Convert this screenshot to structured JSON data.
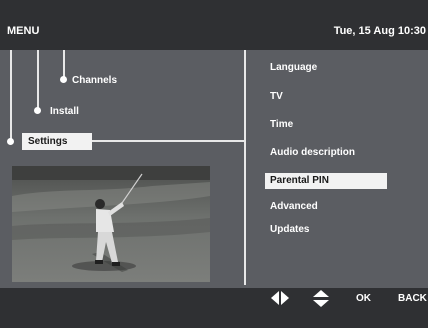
{
  "header": {
    "title": "MENU",
    "datetime": "Tue, 15 Aug 10:30"
  },
  "tree": {
    "level1": "Channels",
    "level2": "Install",
    "level3": "Settings"
  },
  "submenu": {
    "items": [
      "Language",
      "TV",
      "Time",
      "Audio description",
      "Parental PIN",
      "Advanced",
      "Updates"
    ],
    "selected": "Parental PIN"
  },
  "footer": {
    "left_right_icon": "left-right-arrows-icon",
    "up_down_icon": "up-down-arrows-icon",
    "ok_label": "OK",
    "back_label": "BACK"
  },
  "colors": {
    "background": "#5b5d62",
    "bars": "#2f3033",
    "highlight": "#f2f2f2"
  }
}
